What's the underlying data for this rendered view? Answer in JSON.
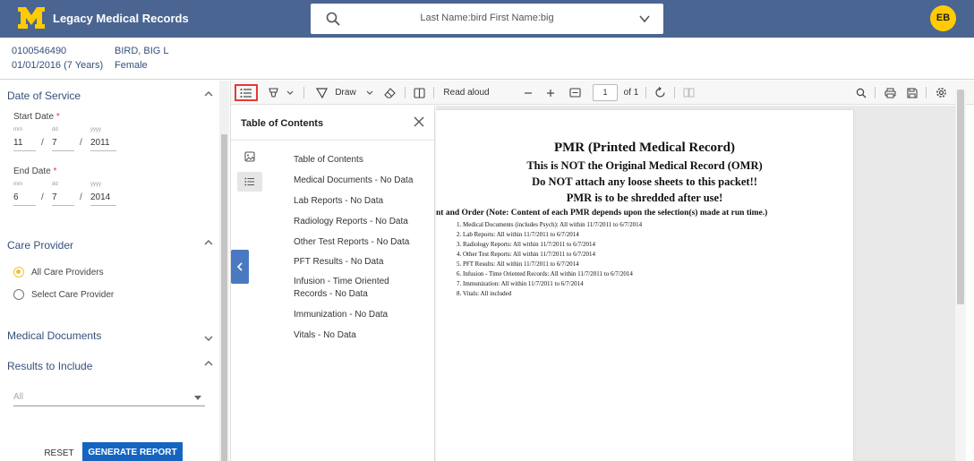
{
  "header": {
    "app_title": "Legacy Medical Records",
    "search_text": "Last Name:bird First Name:big",
    "avatar_initials": "EB",
    "brand_color": "#4a6592",
    "accent_color": "#ffcb05"
  },
  "patient": {
    "mrn": "0100546490",
    "dob_age": "01/01/2016 (7 Years)",
    "name": "BIRD, BIG L",
    "sex": "Female"
  },
  "filters": {
    "date_of_service": {
      "title": "Date of Service",
      "start_label": "Start Date",
      "end_label": "End Date",
      "required_mark": "*",
      "mm_label": "mm",
      "dd_label": "dd",
      "yyyy_label": "yyyy",
      "date_separator": "/",
      "start": {
        "mm": "11",
        "dd": "7",
        "yyyy": "2011"
      },
      "end": {
        "mm": "6",
        "dd": "7",
        "yyyy": "2014"
      }
    },
    "care_provider": {
      "title": "Care Provider",
      "options": [
        {
          "label": "All Care Providers",
          "selected": true
        },
        {
          "label": "Select Care Provider",
          "selected": false
        }
      ]
    },
    "medical_documents": {
      "title": "Medical Documents"
    },
    "results_to_include": {
      "title": "Results to Include",
      "select_value": "All"
    },
    "reset_label": "RESET",
    "generate_label": "GENERATE REPORT"
  },
  "toolbar": {
    "draw_label": "Draw",
    "read_aloud_label": "Read aloud",
    "page_number": "1",
    "page_of": "of 1"
  },
  "toc": {
    "title": "Table of Contents",
    "items": [
      "Table of Contents",
      "Medical Documents - No Data",
      "Lab Reports - No Data",
      "Radiology Reports - No Data",
      "Other Test Reports - No Data",
      "PFT Results - No Data",
      "Infusion - Time Oriented Records - No Data",
      "Immunization - No Data",
      "Vitals - No Data"
    ]
  },
  "document": {
    "heading1": "PMR (Printed Medical Record)",
    "heading2": "This is NOT the Original Medical Record (OMR)",
    "heading3": "Do NOT attach any loose sheets to this packet!!",
    "heading4": "PMR is to be shredded after use!",
    "content_line": "nt and Order (Note: Content of each PMR depends upon the selection(s) made at run time.)",
    "list": [
      "1. Medical Documents (includes Psych): All within 11/7/2011 to 6/7/2014",
      "2. Lab Reports: All within 11/7/2011 to 6/7/2014",
      "3. Radiology Reports: All within 11/7/2011 to 6/7/2014",
      "4. Other Test Reports: All within 11/7/2011 to 6/7/2014",
      "5. PFT Results: All within 11/7/2011 to 6/7/2014",
      "6. Infusion - Time Oriented Records: All within 11/7/2011 to 6/7/2014",
      "7. Immunization: All within 11/7/2011 to 6/7/2014",
      "8. Vitals: All included"
    ]
  }
}
